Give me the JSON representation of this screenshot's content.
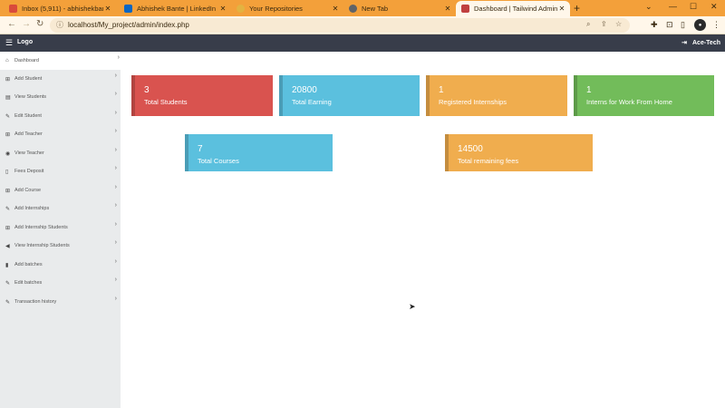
{
  "browser": {
    "tabs": [
      {
        "title": "Inbox (5,911) - abhishekbante01@",
        "color": "#d94a3b"
      },
      {
        "title": "Abhishek Bante | LinkedIn",
        "color": "#0a66c2"
      },
      {
        "title": "Your Repositories",
        "color": "#e3b341"
      },
      {
        "title": "New Tab",
        "color": "#5f6368"
      },
      {
        "title": "Dashboard | Tailwind Admin",
        "color": "#c04040"
      }
    ],
    "new_tab": "+",
    "url": "localhost/My_project/admin/index.php"
  },
  "header": {
    "menu_icon": "☰",
    "logo": "Logo",
    "brand": "Ace-Tech",
    "logout_icon": "⇥"
  },
  "sidebar": {
    "items": [
      {
        "label": "Dashboard",
        "icon": "dashboard-icon"
      },
      {
        "label": "Add Student",
        "icon": "add-icon"
      },
      {
        "label": "View Students",
        "icon": "list-icon"
      },
      {
        "label": "Edit Student",
        "icon": "edit-icon"
      },
      {
        "label": "Add Teacher",
        "icon": "add-icon"
      },
      {
        "label": "View Teacher",
        "icon": "eye-icon"
      },
      {
        "label": "Fees Deposit",
        "icon": "file-icon"
      },
      {
        "label": "Add Course",
        "icon": "add-icon"
      },
      {
        "label": "Add Internships",
        "icon": "edit-icon"
      },
      {
        "label": "Add Internship Students",
        "icon": "add-icon"
      },
      {
        "label": "View Internship Students",
        "icon": "megaphone-icon"
      },
      {
        "label": "Add batches",
        "icon": "bookmark-icon"
      },
      {
        "label": "Edit batches",
        "icon": "edit-icon"
      },
      {
        "label": "Transaction history",
        "icon": "edit-icon"
      }
    ]
  },
  "cards": [
    {
      "value": "3",
      "label": "Total Students",
      "color": "#d9534f"
    },
    {
      "value": "20800",
      "label": "Total Earning",
      "color": "#5bc0de"
    },
    {
      "value": "1",
      "label": "Registered Internships",
      "color": "#f0ad4e"
    },
    {
      "value": "1",
      "label": "Interns for Work From Home",
      "color": "#72bc5a"
    },
    {
      "value": "7",
      "label": "Total Courses",
      "color": "#5bc0de"
    },
    {
      "value": "14500",
      "label": "Total remaining fees",
      "color": "#f0ad4e"
    }
  ]
}
